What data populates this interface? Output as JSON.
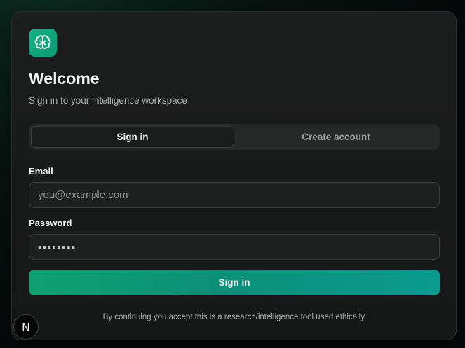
{
  "header": {
    "title": "Welcome",
    "subtitle": "Sign in to your intelligence workspace",
    "logo_icon": "brain-icon"
  },
  "tabs": [
    {
      "label": "Sign in",
      "active": true
    },
    {
      "label": "Create account",
      "active": false
    }
  ],
  "form": {
    "email_label": "Email",
    "email_placeholder": "you@example.com",
    "email_value": "",
    "password_label": "Password",
    "password_value": "••••••••",
    "submit_label": "Sign in"
  },
  "footer": {
    "notice": "By continuing you accept this is a research/intelligence tool used ethically."
  },
  "badge": {
    "letter": "N"
  },
  "colors": {
    "accent": "#10a37f",
    "background": "#161817"
  }
}
